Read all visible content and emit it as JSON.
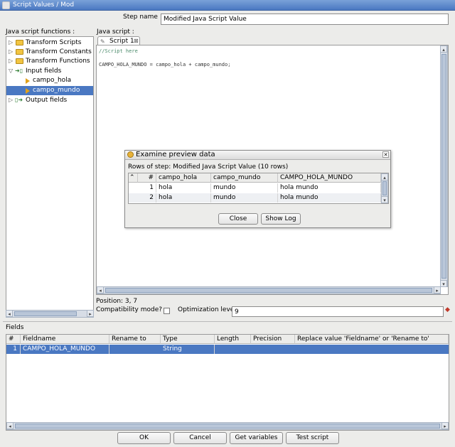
{
  "window": {
    "title": "Script Values / Mod"
  },
  "step": {
    "label": "Step name",
    "value": "Modified Java Script Value"
  },
  "functions_panel": {
    "label": "Java script functions :",
    "items": [
      {
        "label": "Transform Scripts",
        "icon": "folder-icon"
      },
      {
        "label": "Transform Constants",
        "icon": "folder-icon"
      },
      {
        "label": "Transform Functions",
        "icon": "folder-icon"
      },
      {
        "label": "Input fields",
        "icon": "input-fields-icon"
      },
      {
        "label": "campo_hola",
        "icon": "field-icon"
      },
      {
        "label": "campo_mundo",
        "icon": "field-icon",
        "selected": true
      },
      {
        "label": "Output fields",
        "icon": "output-fields-icon"
      }
    ]
  },
  "script_panel": {
    "label": "Java script :",
    "tab_label": "Script 1",
    "code_comment": "//Script here",
    "code_line": "CAMPO_HOLA_MUNDO = campo_hola + campo_mundo;"
  },
  "position": {
    "text": "Position: 3, 7"
  },
  "compat": {
    "label": "Compatibility mode?"
  },
  "optimization": {
    "label": "Optimization level",
    "value": "9"
  },
  "fields": {
    "label": "Fields",
    "columns": [
      "#",
      "Fieldname",
      "Rename to",
      "Type",
      "Length",
      "Precision",
      "Replace value 'Fieldname' or 'Rename to'"
    ],
    "rows": [
      {
        "num": "1",
        "fieldname": "CAMPO_HOLA_MUNDO",
        "rename": "",
        "type": "String",
        "length": "",
        "precision": "",
        "replace": ""
      }
    ]
  },
  "preview": {
    "title": "Examine preview data",
    "subtitle": "Rows of step: Modified Java Script Value (10 rows)",
    "columns": [
      "#",
      "campo_hola",
      "campo_mundo",
      "CAMPO_HOLA_MUNDO"
    ],
    "rows": [
      {
        "num": "1",
        "hola": "hola",
        "mundo": "mundo",
        "result": "hola mundo"
      },
      {
        "num": "2",
        "hola": "hola",
        "mundo": "mundo",
        "result": "hola mundo"
      }
    ],
    "close_label": "Close",
    "showlog_label": "Show Log"
  },
  "buttons": {
    "ok": "OK",
    "cancel": "Cancel",
    "get_variables": "Get variables",
    "test_script": "Test script"
  },
  "colors": {
    "title_bar": "#4a78c2",
    "selection": "#4a78c2",
    "folder": "#f2c542"
  }
}
